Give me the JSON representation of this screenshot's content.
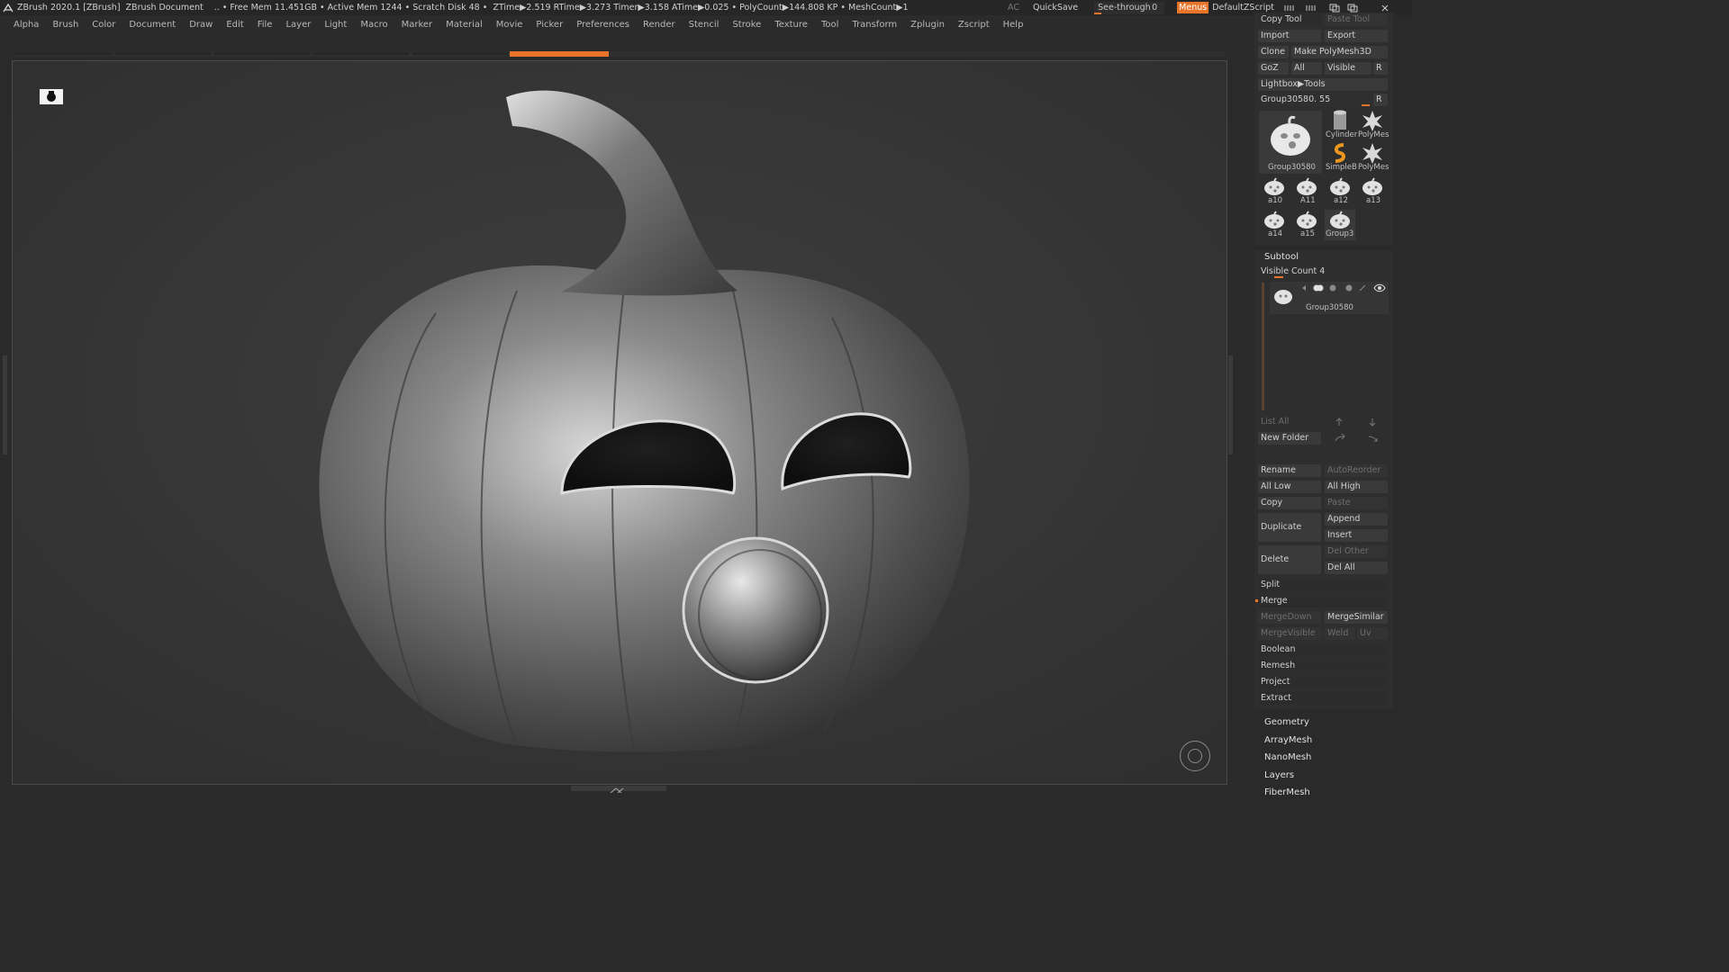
{
  "titlebar": {
    "app": "ZBrush 2020.1 [ZBrush]",
    "doc": "ZBrush Document",
    "stats": ".. • Free Mem 11.451GB • Active Mem 1244 • Scratch Disk 48 •",
    "timing": "ZTime▶2.519 RTime▶3.273 Timer▶3.158 ATime▶0.025 • PolyCount▶144.808 KP • MeshCount▶1",
    "ac": "AC",
    "quicksave": "QuickSave",
    "seethrough_label": "See-through",
    "seethrough_value": "0",
    "menus": "Menus",
    "script": "DefaultZScript"
  },
  "menu": [
    "Alpha",
    "Brush",
    "Color",
    "Document",
    "Draw",
    "Edit",
    "File",
    "Layer",
    "Light",
    "Macro",
    "Marker",
    "Material",
    "Movie",
    "Picker",
    "Preferences",
    "Render",
    "Stencil",
    "Stroke",
    "Texture",
    "Tool",
    "Transform",
    "Zplugin",
    "Zscript",
    "Help"
  ],
  "progress": {
    "fraction": 0.08
  },
  "tool": {
    "copy_tool": "Copy Tool",
    "paste_tool": "Paste Tool",
    "import": "Import",
    "export": "Export",
    "clone": "Clone",
    "make_polymesh": "Make PolyMesh3D",
    "goz": "GoZ",
    "all": "All",
    "visible": "Visible",
    "r": "R",
    "lightbox": "Lightbox▶Tools",
    "current": "Group30580. 55",
    "slider_fraction": 0.95,
    "r2": "R",
    "big_thumb_label": "Group30580",
    "small_thumbs": [
      {
        "label": "Cylinder",
        "icon": "cylinder-icon"
      },
      {
        "label": "PolyMes",
        "icon": "star-polymesh-icon"
      },
      {
        "label": "SimpleB",
        "icon": "simplebrush-icon"
      },
      {
        "label": "PolyMes",
        "icon": "star-polymesh-icon"
      }
    ],
    "grid_thumbs": [
      "a10",
      "A11",
      "a12",
      "a13",
      "a14",
      "a15",
      "Group3"
    ]
  },
  "subtool": {
    "title": "Subtool",
    "visible_count": "Visible Count 4",
    "item_label": "Group30580",
    "list_all": "List All",
    "new_folder": "New Folder",
    "rename": "Rename",
    "autoreorder": "AutoReorder",
    "all_low": "All Low",
    "all_high": "All High",
    "copy": "Copy",
    "paste": "Paste",
    "duplicate": "Duplicate",
    "append": "Append",
    "insert": "Insert",
    "delete": "Delete",
    "del_other": "Del Other",
    "del_all": "Del All",
    "split": "Split",
    "merge": "Merge",
    "mergedown": "MergeDown",
    "mergesimilar": "MergeSimilar",
    "mergevisible": "MergeVisible",
    "weld": "Weld",
    "uv": "Uv",
    "boolean": "Boolean",
    "remesh": "Remesh",
    "project": "Project",
    "extract": "Extract"
  },
  "sections": [
    "Geometry",
    "ArrayMesh",
    "NanoMesh",
    "Layers",
    "FiberMesh"
  ],
  "colors": {
    "accent": "#e8752a",
    "panel": "#2e2e2e",
    "button": "#3a3a3a"
  }
}
